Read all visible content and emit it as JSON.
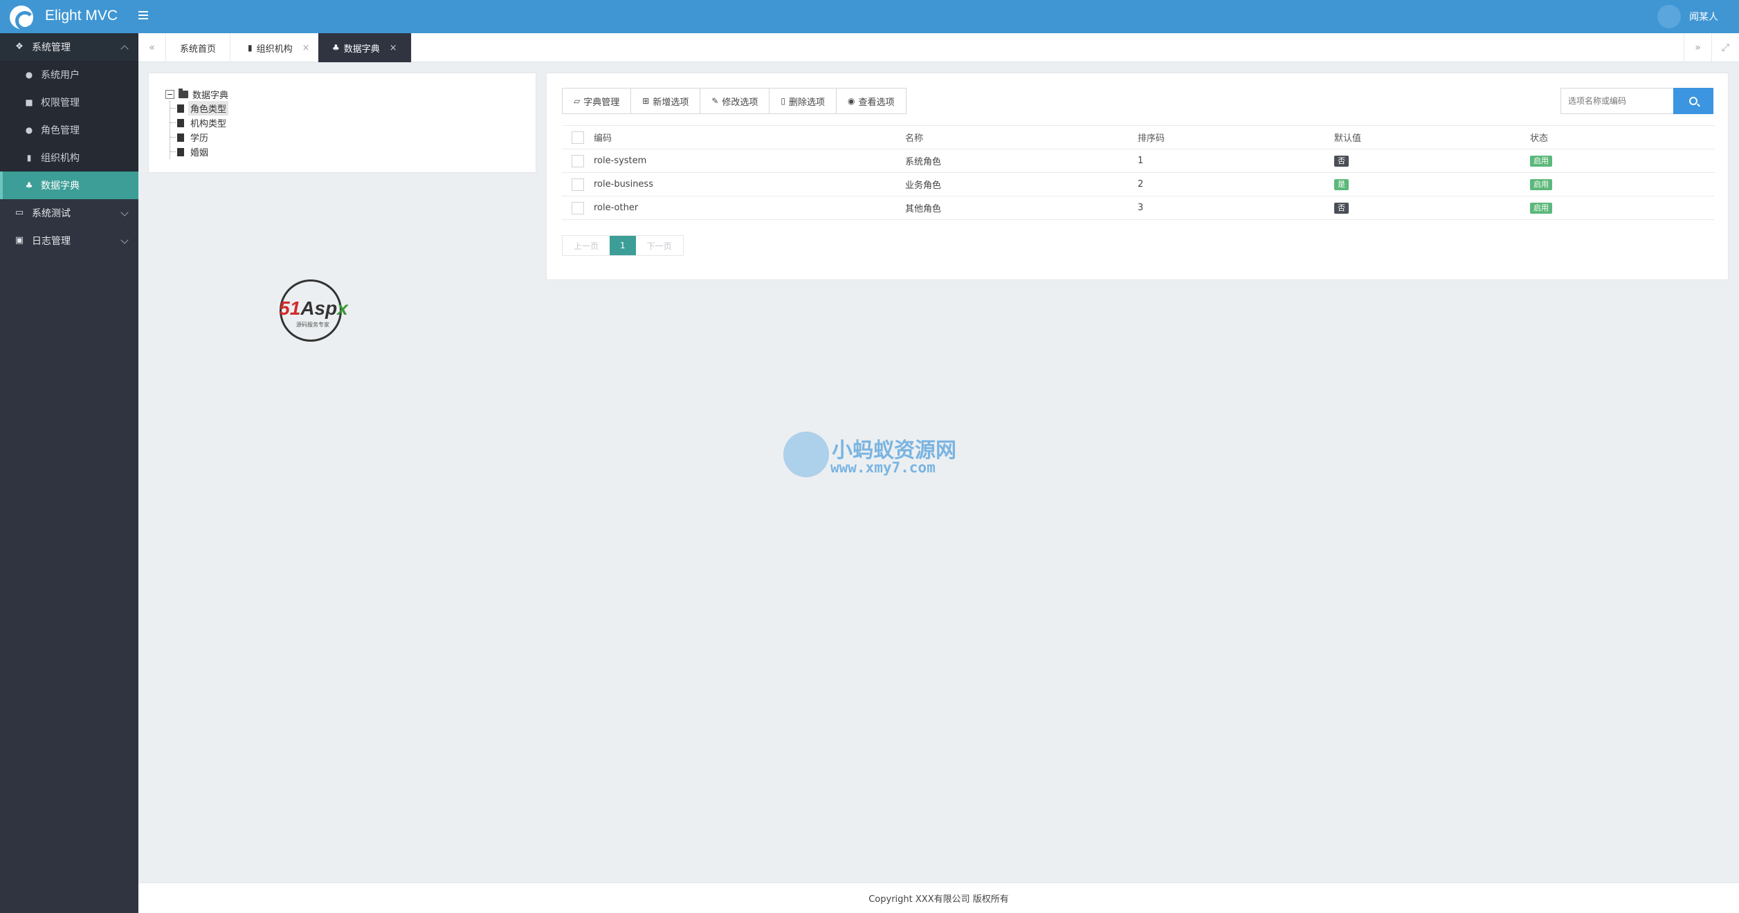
{
  "app": {
    "title": "Elight MVC",
    "user": "闻某人"
  },
  "sidebar": {
    "groups": [
      {
        "label": "系统管理",
        "icon": "cubes-icon",
        "items": [
          {
            "label": "系统用户",
            "icon": "user-icon"
          },
          {
            "label": "权限管理",
            "icon": "briefcase-icon"
          },
          {
            "label": "角色管理",
            "icon": "users-icon"
          },
          {
            "label": "组织机构",
            "icon": "building-icon"
          },
          {
            "label": "数据字典",
            "icon": "sitemap-icon"
          }
        ]
      },
      {
        "label": "系统测试",
        "icon": "desktop-icon"
      },
      {
        "label": "日志管理",
        "icon": "save-icon"
      }
    ]
  },
  "tabs": [
    {
      "label": "系统首页"
    },
    {
      "label": "组织机构",
      "closable": true
    },
    {
      "label": "数据字典",
      "closable": true,
      "active": true
    }
  ],
  "tree": {
    "root": "数据字典",
    "children": [
      "角色类型",
      "机构类型",
      "学历",
      "婚姻"
    ],
    "selected": "角色类型"
  },
  "stamp": {
    "brand": "51Aspx",
    "slogan": "源码服务专家"
  },
  "watermark": {
    "title": "小蚂蚁资源网",
    "url": "www.xmy7.com"
  },
  "toolbar": {
    "buttons": [
      "字典管理",
      "新增选项",
      "修改选项",
      "删除选项",
      "查看选项"
    ]
  },
  "search": {
    "placeholder": "选项名称或编码"
  },
  "table": {
    "headers": [
      "编码",
      "名称",
      "排序码",
      "默认值",
      "状态"
    ],
    "rows": [
      {
        "code": "role-system",
        "name": "系统角色",
        "sort": "1",
        "default": "否",
        "status": "启用"
      },
      {
        "code": "role-business",
        "name": "业务角色",
        "sort": "2",
        "default": "是",
        "status": "启用"
      },
      {
        "code": "role-other",
        "name": "其他角色",
        "sort": "3",
        "default": "否",
        "status": "启用"
      }
    ]
  },
  "pager": {
    "prev": "上一页",
    "current": "1",
    "next": "下一页"
  },
  "footer": {
    "text": "Copyright XXX有限公司 版权所有"
  },
  "colors": {
    "header": "#3f96d3",
    "sidebar": "#2f3440",
    "accent": "#3c9e96",
    "search": "#3b95e0"
  }
}
